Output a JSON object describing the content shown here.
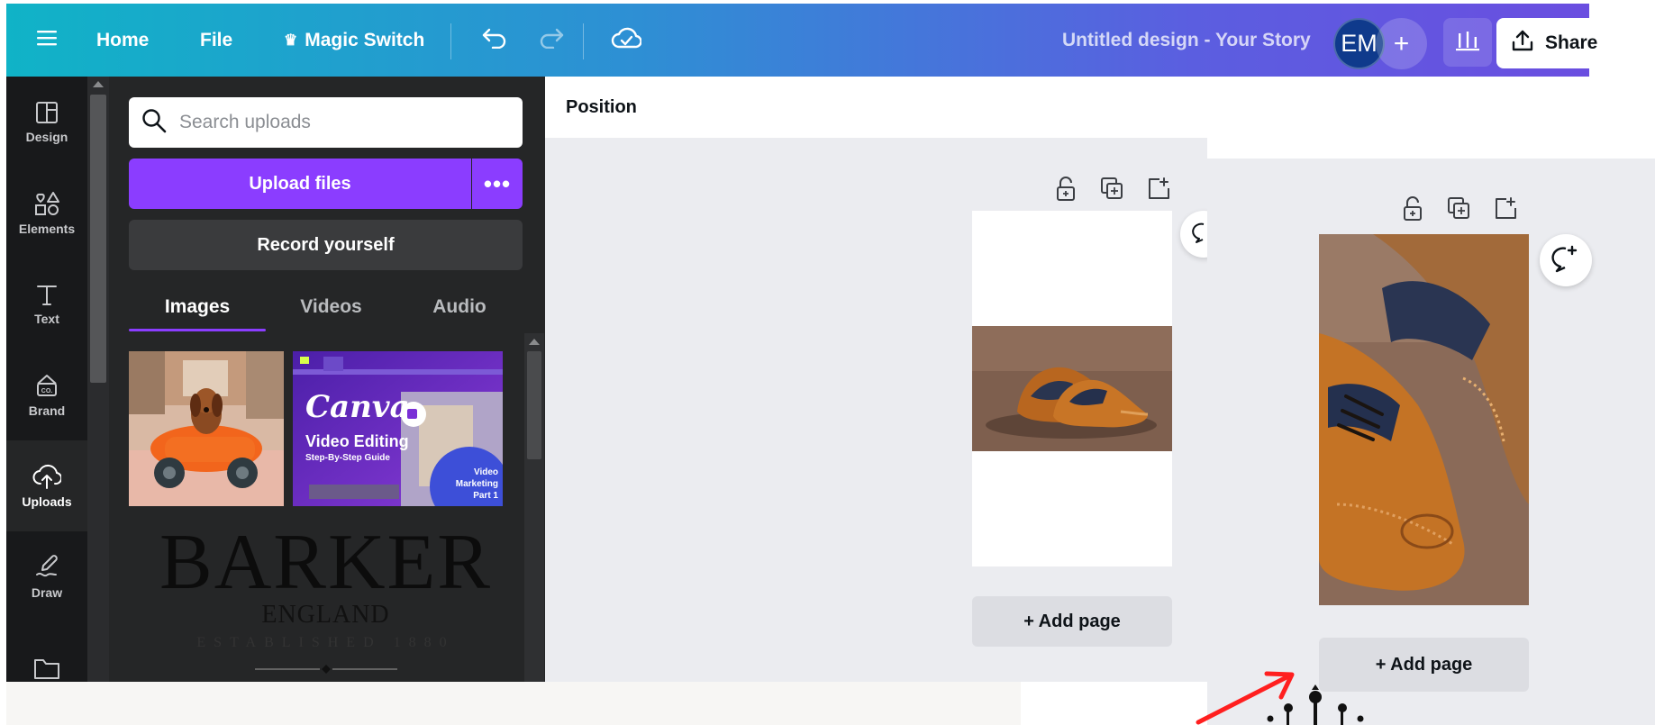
{
  "header": {
    "menu_icon": "hamburger-icon",
    "home_label": "Home",
    "file_label": "File",
    "magic_switch_label": "Magic Switch",
    "magic_icon": "crown-icon",
    "undo_icon": "undo-icon",
    "redo_icon": "redo-icon",
    "cloud_icon": "cloud-check-icon",
    "design_title": "Untitled design - Your Story",
    "avatar_initials": "EM",
    "add_collaborator_label": "+",
    "stats_icon": "bar-chart-icon",
    "share_label": "Share",
    "share_icon": "upload-icon",
    "gradient_colors": [
      "#10b3c7",
      "#5b5ee0",
      "#6a4ee0"
    ]
  },
  "sidebar": {
    "items": [
      {
        "label": "Design",
        "icon": "layout-icon"
      },
      {
        "label": "Elements",
        "icon": "shapes-icon"
      },
      {
        "label": "Text",
        "icon": "text-icon"
      },
      {
        "label": "Brand",
        "icon": "brand-kit-icon"
      },
      {
        "label": "Uploads",
        "icon": "cloud-upload-icon",
        "active": true
      },
      {
        "label": "Draw",
        "icon": "pen-icon"
      },
      {
        "label": "",
        "icon": "folder-icon"
      }
    ]
  },
  "uploads_panel": {
    "search_placeholder": "Search uploads",
    "upload_label": "Upload files",
    "more_label": "•••",
    "record_label": "Record yourself",
    "tabs": [
      {
        "label": "Images",
        "active": true
      },
      {
        "label": "Videos",
        "active": false
      },
      {
        "label": "Audio",
        "active": false
      }
    ],
    "thumb_canva": {
      "brand": "Canva",
      "title": "Video Editing",
      "subtitle": "Step-By-Step Guide",
      "badge_line1": "Video",
      "badge_line2": "Marketing",
      "badge_line3": "Part 1"
    },
    "thumb_barker": {
      "name": "BARKER",
      "country": "ENGLAND",
      "established": "ESTABLISHED 1880"
    },
    "accent_color": "#8b3dff"
  },
  "editor": {
    "toolbar_label": "Position",
    "add_page_label": "+ Add page",
    "zoom_add_page_label": "+ Add page",
    "page_action_icons": [
      "unlock-icon",
      "duplicate-page-icon",
      "add-page-icon"
    ],
    "comment_icon": "add-comment-icon"
  }
}
